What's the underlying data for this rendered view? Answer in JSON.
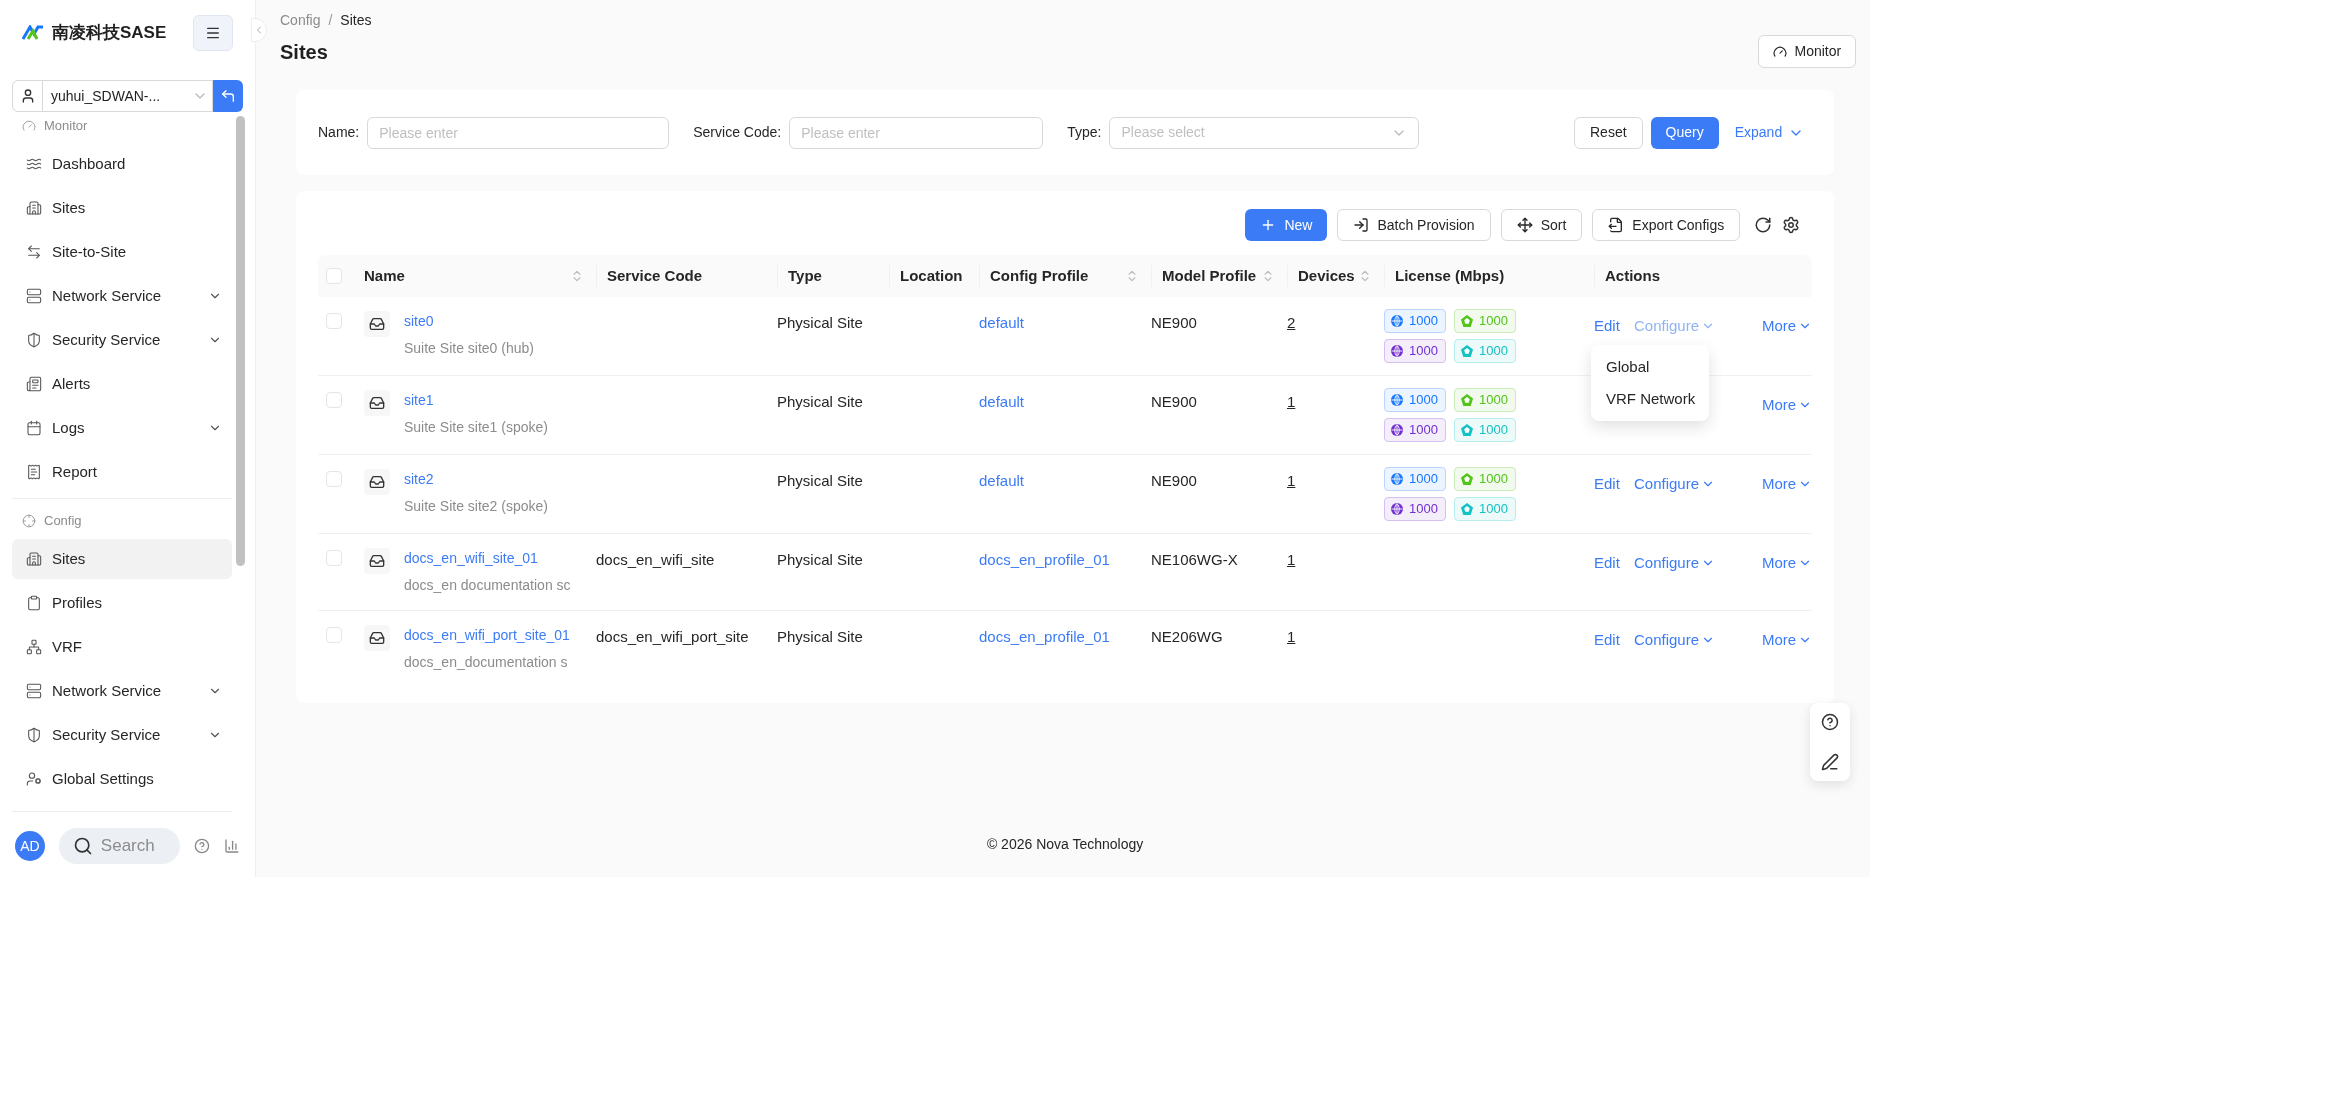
{
  "sidebar": {
    "logo_text": "南凌科技SASE",
    "tenant": "yuhui_SDWAN-...",
    "sections": [
      {
        "title": "Monitor",
        "items": [
          {
            "label": "Dashboard",
            "expandable": false,
            "selected": false
          },
          {
            "label": "Sites",
            "expandable": false,
            "selected": false
          },
          {
            "label": "Site-to-Site",
            "expandable": false,
            "selected": false
          },
          {
            "label": "Network Service",
            "expandable": true,
            "selected": false
          },
          {
            "label": "Security Service",
            "expandable": true,
            "selected": false
          },
          {
            "label": "Alerts",
            "expandable": false,
            "selected": false
          },
          {
            "label": "Logs",
            "expandable": true,
            "selected": false
          },
          {
            "label": "Report",
            "expandable": false,
            "selected": false
          }
        ]
      },
      {
        "title": "Config",
        "items": [
          {
            "label": "Sites",
            "expandable": false,
            "selected": true
          },
          {
            "label": "Profiles",
            "expandable": false,
            "selected": false
          },
          {
            "label": "VRF",
            "expandable": false,
            "selected": false
          },
          {
            "label": "Network Service",
            "expandable": true,
            "selected": false
          },
          {
            "label": "Security Service",
            "expandable": true,
            "selected": false
          },
          {
            "label": "Global Settings",
            "expandable": false,
            "selected": false
          }
        ]
      }
    ],
    "avatar": "AD",
    "search_placeholder": "Search"
  },
  "breadcrumb": [
    "Config",
    "Sites"
  ],
  "breadcrumb_separator": "/",
  "page_title": "Sites",
  "monitor_button": "Monitor",
  "filter_label_suffix": ":",
  "filters": [
    {
      "label": "Name",
      "placeholder": "Please enter",
      "kind": "input"
    },
    {
      "label": "Service Code",
      "placeholder": "Please enter",
      "kind": "input"
    },
    {
      "label": "Type",
      "placeholder": "Please select",
      "kind": "select"
    }
  ],
  "filter_buttons": {
    "reset": "Reset",
    "query": "Query",
    "expand": "Expand"
  },
  "toolbar": [
    {
      "label": "New",
      "kind": "primary"
    },
    {
      "label": "Batch Provision",
      "kind": "batch"
    },
    {
      "label": "Sort",
      "kind": "sort"
    },
    {
      "label": "Export Configs",
      "kind": "export"
    }
  ],
  "table": {
    "all_checked": false,
    "columns": [
      {
        "label": "Name",
        "sortable": true
      },
      {
        "label": "Service Code",
        "sortable": false
      },
      {
        "label": "Type",
        "sortable": false
      },
      {
        "label": "Location",
        "sortable": false
      },
      {
        "label": "Config Profile",
        "sortable": true
      },
      {
        "label": "Model Profile",
        "sortable": true
      },
      {
        "label": "Devices",
        "sortable": true
      },
      {
        "label": "License (Mbps)",
        "sortable": false
      },
      {
        "label": "Actions",
        "sortable": false
      }
    ],
    "rows": [
      {
        "checked": false,
        "name": "site0",
        "description": "Suite Site site0 (hub)",
        "type": "Physical Site",
        "config_profile": "default",
        "model_profile": "NE900",
        "devices": "2",
        "licenses": [
          {
            "value": "1000",
            "kind": "globe",
            "color": "#1677ff"
          },
          {
            "value": "1000",
            "kind": "pentagon",
            "color": "#52c41a"
          },
          {
            "value": "1000",
            "kind": "globe",
            "color": "#722ed1"
          },
          {
            "value": "1000",
            "kind": "pentagon",
            "color": "#13c2c2"
          }
        ],
        "actions": [
          {
            "label": "Edit",
            "kind": "edit",
            "open": false
          },
          {
            "label": "Configure",
            "kind": "configure",
            "open": true
          },
          {
            "label": "More",
            "kind": "more",
            "open": false
          }
        ]
      },
      {
        "checked": false,
        "name": "site1",
        "description": "Suite Site site1 (spoke)",
        "type": "Physical Site",
        "config_profile": "default",
        "model_profile": "NE900",
        "devices": "1",
        "licenses": [
          {
            "value": "1000",
            "kind": "globe",
            "color": "#1677ff"
          },
          {
            "value": "1000",
            "kind": "pentagon",
            "color": "#52c41a"
          },
          {
            "value": "1000",
            "kind": "globe",
            "color": "#722ed1"
          },
          {
            "value": "1000",
            "kind": "pentagon",
            "color": "#13c2c2"
          }
        ],
        "actions": [
          {
            "label": "More",
            "kind": "more",
            "open": false
          }
        ]
      },
      {
        "checked": false,
        "name": "site2",
        "description": "Suite Site site2 (spoke)",
        "type": "Physical Site",
        "config_profile": "default",
        "model_profile": "NE900",
        "devices": "1",
        "licenses": [
          {
            "value": "1000",
            "kind": "globe",
            "color": "#1677ff"
          },
          {
            "value": "1000",
            "kind": "pentagon",
            "color": "#52c41a"
          },
          {
            "value": "1000",
            "kind": "globe",
            "color": "#722ed1"
          },
          {
            "value": "1000",
            "kind": "pentagon",
            "color": "#13c2c2"
          }
        ],
        "actions": [
          {
            "label": "Edit",
            "kind": "edit",
            "open": false
          },
          {
            "label": "Configure",
            "kind": "configure",
            "open": false
          },
          {
            "label": "More",
            "kind": "more",
            "open": false
          }
        ]
      },
      {
        "checked": false,
        "name": "docs_en_wifi_site_01",
        "description": "docs_en documentation sc",
        "service_code": "docs_en_wifi_site",
        "type": "Physical Site",
        "config_profile": "docs_en_profile_01",
        "model_profile": "NE106WG-X",
        "devices": "1",
        "actions": [
          {
            "label": "Edit",
            "kind": "edit",
            "open": false
          },
          {
            "label": "Configure",
            "kind": "configure",
            "open": false
          },
          {
            "label": "More",
            "kind": "more",
            "open": false
          }
        ]
      },
      {
        "checked": false,
        "name": "docs_en_wifi_port_site_01",
        "description": "docs_en_documentation s",
        "service_code": "docs_en_wifi_port_site",
        "type": "Physical Site",
        "config_profile": "docs_en_profile_01",
        "model_profile": "NE206WG",
        "devices": "1",
        "actions": [
          {
            "label": "Edit",
            "kind": "edit",
            "open": false
          },
          {
            "label": "Configure",
            "kind": "configure",
            "open": false
          },
          {
            "label": "More",
            "kind": "more",
            "open": false
          }
        ]
      }
    ]
  },
  "dropdown_menu": [
    "Global",
    "VRF Network"
  ],
  "footer": "© 2026 Nova Technology"
}
